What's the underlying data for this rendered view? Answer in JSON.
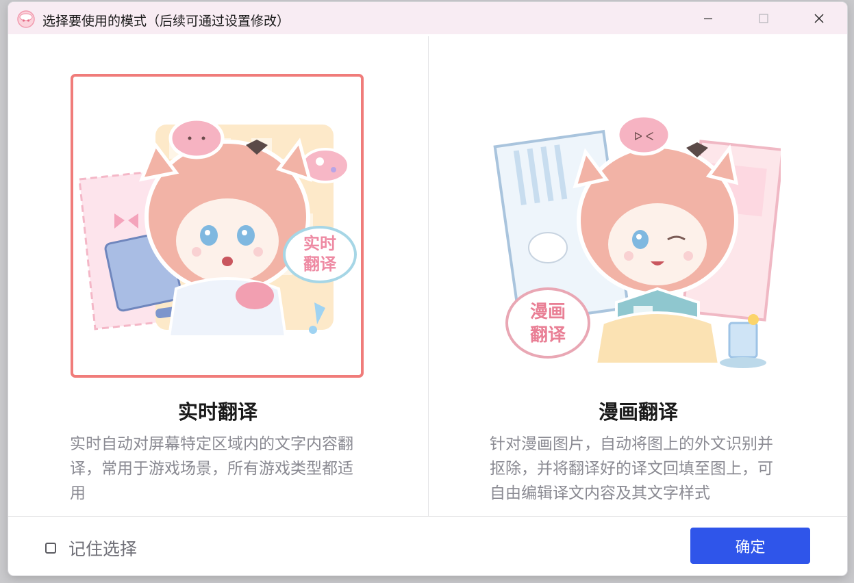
{
  "window": {
    "title": "选择要使用的模式（后续可通过设置修改）"
  },
  "modes": [
    {
      "title": "实时翻译",
      "description": "实时自动对屏幕特定区域内的文字内容翻译，常用于游戏场景，所有游戏类型都适用",
      "badge": [
        "实时",
        "翻译"
      ],
      "selected": true
    },
    {
      "title": "漫画翻译",
      "description": "针对漫画图片，自动将图上的外文识别并抠除，并将翻译好的译文回填至图上，可自由编辑译文内容及其文字样式",
      "badge": [
        "漫画",
        "翻译"
      ],
      "selected": false
    }
  ],
  "footer": {
    "remember_label": "记住选择",
    "remember_checked": false,
    "confirm_label": "确定"
  },
  "colors": {
    "accent": "#2f55ea",
    "selected_border": "#f07c7a",
    "titlebar": "#f8ecf3"
  }
}
